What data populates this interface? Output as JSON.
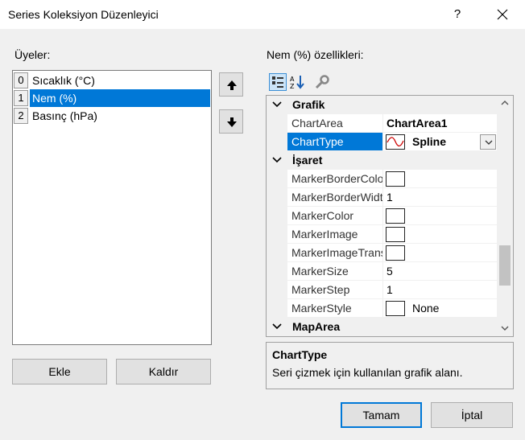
{
  "window": {
    "title": "Series Koleksiyon Düzenleyici",
    "help": "?"
  },
  "members": {
    "label": "Üyeler:",
    "items": [
      {
        "index": "0",
        "text": "Sıcaklık (°C)",
        "selected": false
      },
      {
        "index": "1",
        "text": "Nem (%)",
        "selected": true
      },
      {
        "index": "2",
        "text": "Basınç (hPa)",
        "selected": false
      }
    ]
  },
  "buttons": {
    "add": "Ekle",
    "remove": "Kaldır",
    "ok": "Tamam",
    "cancel": "İptal"
  },
  "properties": {
    "label": "Nem (%) özellikleri:",
    "categories": [
      {
        "name": "Grafik",
        "rows": [
          {
            "name": "ChartArea",
            "value": "ChartArea1",
            "bold": true
          },
          {
            "name": "ChartType",
            "value": "Spline",
            "bold": true,
            "selected": true
          }
        ]
      },
      {
        "name": "İşaret",
        "rows": [
          {
            "name": "MarkerBorderColor",
            "value": ""
          },
          {
            "name": "MarkerBorderWidth",
            "value": "1"
          },
          {
            "name": "MarkerColor",
            "value": ""
          },
          {
            "name": "MarkerImage",
            "value": ""
          },
          {
            "name": "MarkerImageTransparentColor",
            "value": ""
          },
          {
            "name": "MarkerSize",
            "value": "5"
          },
          {
            "name": "MarkerStep",
            "value": "1"
          },
          {
            "name": "MarkerStyle",
            "value": "None"
          }
        ]
      },
      {
        "name": "MapArea",
        "rows": []
      }
    ]
  },
  "description": {
    "title": "ChartType",
    "text": "Seri çizmek için kullanılan grafik alanı."
  },
  "colors": {
    "selection": "#0078d7",
    "accent_border": "#0078d7",
    "spline_curve": "#cc0000"
  }
}
